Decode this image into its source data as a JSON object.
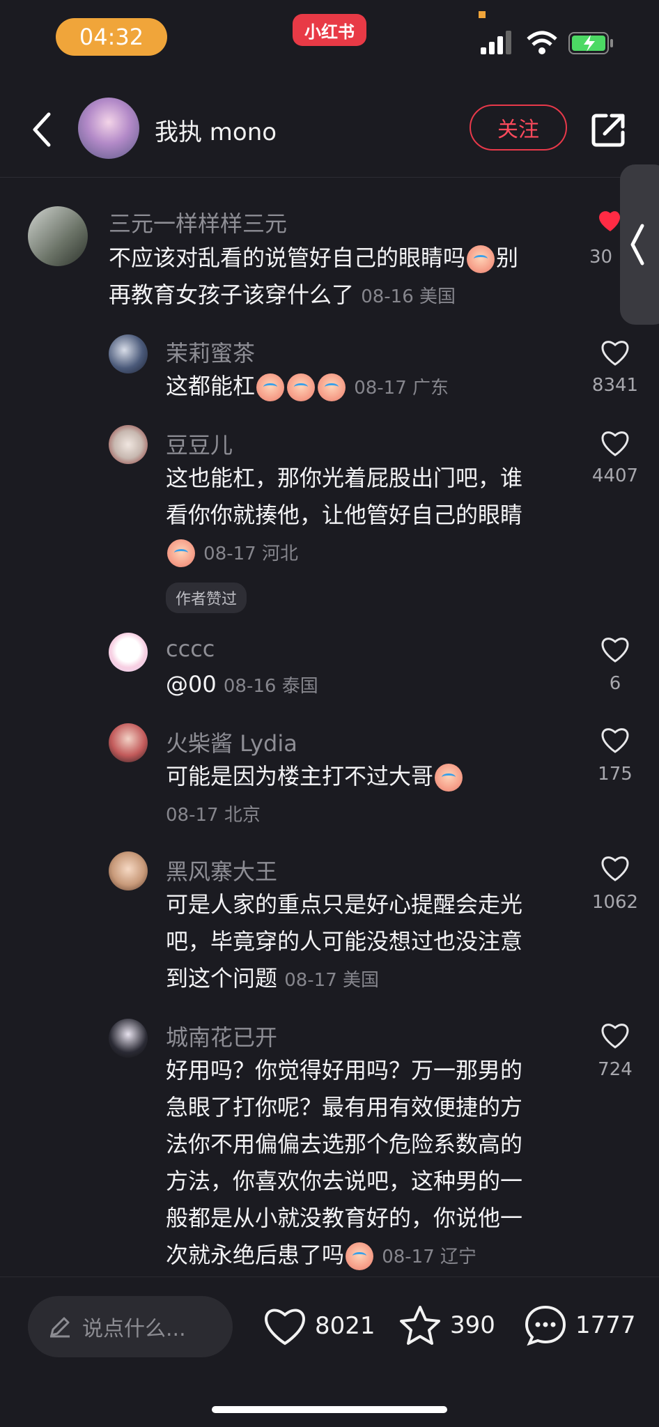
{
  "status": {
    "time": "04:32",
    "app_badge": "小红书"
  },
  "header": {
    "username": "我执 mono",
    "follow_label": "关注"
  },
  "top_comment": {
    "name": "三元一样样样三元",
    "text_line1": "不应该对乱看的说管好自己的眼睛吗",
    "text_line1_tail": "别",
    "text_line2": "再教育女孩子该穿什么了",
    "meta": "08-16 美国",
    "likes": "30"
  },
  "replies": [
    {
      "name": "茉莉蜜茶",
      "text": "这都能杠",
      "meta": "08-17 广东",
      "likes": "8341"
    },
    {
      "name": "豆豆儿",
      "line1": "这也能杠，那你光着屁股出门吧，谁",
      "line2": "看你你就揍他，让他管好自己的眼睛",
      "meta": "08-17 河北",
      "badge": "作者赞过",
      "likes": "4407"
    },
    {
      "name": "cccc",
      "text": "@00",
      "meta": "08-16 泰国",
      "likes": "6"
    },
    {
      "name": "火柴酱 Lydia",
      "text": "可能是因为楼主打不过大哥",
      "meta": "08-17 北京",
      "likes": "175"
    },
    {
      "name": "黑风寨大王",
      "line1": "可是人家的重点只是好心提醒会走光",
      "line2": "吧，毕竟穿的人可能没想过也没注意",
      "line3": "到这个问题",
      "meta": "08-17 美国",
      "likes": "1062"
    },
    {
      "name": "城南花已开",
      "line1": "好用吗？你觉得好用吗？万一那男的",
      "line2": "急眼了打你呢？最有用有效便捷的方",
      "line3": "法你不用偏偏去选那个危险系数高的",
      "line4": "方法，你喜欢你去说吧，这种男的一",
      "line5": "般都是从小就没教育好的，你说他一",
      "line6": "次就永绝后患了吗",
      "meta": "08-17 辽宁",
      "likes": "724"
    }
  ],
  "bottom": {
    "placeholder": "说点什么...",
    "likes": "8021",
    "stars": "390",
    "comments": "1777"
  },
  "colors": {
    "accent": "#e8394a",
    "background": "#1b1b21"
  }
}
